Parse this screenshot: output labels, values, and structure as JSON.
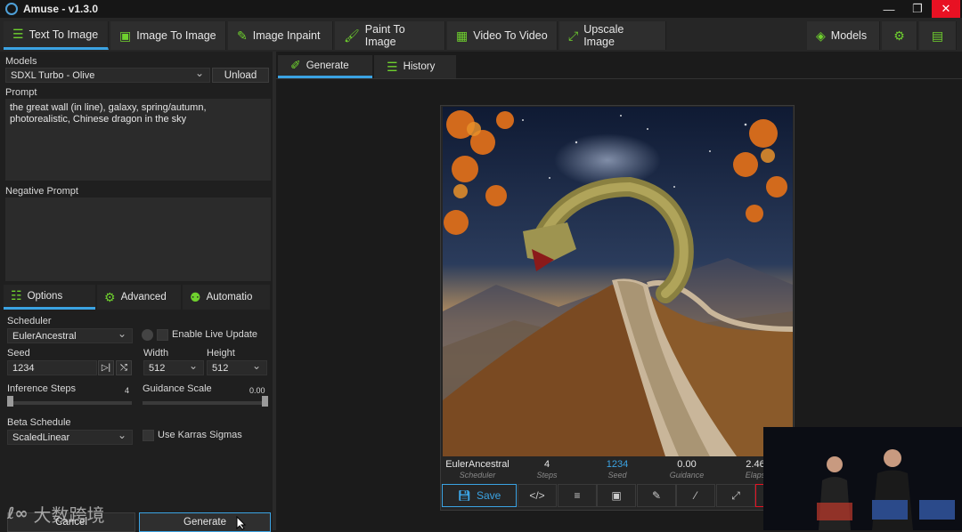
{
  "window": {
    "title": "Amuse - v1.3.0",
    "minimize": "—",
    "restore": "❐",
    "close": "✕"
  },
  "tabs": [
    {
      "label": "Text To Image",
      "icon": "text-lines-icon"
    },
    {
      "label": "Image To Image",
      "icon": "image-icon"
    },
    {
      "label": "Image Inpaint",
      "icon": "edit-icon"
    },
    {
      "label": "Paint To Image",
      "icon": "brush-icon"
    },
    {
      "label": "Video To Video",
      "icon": "film-icon"
    },
    {
      "label": "Upscale Image",
      "icon": "expand-icon"
    }
  ],
  "right_tabs": {
    "models": "Models"
  },
  "left": {
    "models_label": "Models",
    "model_value": "SDXL Turbo - Olive",
    "unload": "Unload",
    "prompt_label": "Prompt",
    "prompt_text": "the great wall (in line), galaxy, spring/autumn, photorealistic, Chinese dragon in the sky",
    "negative_label": "Negative Prompt",
    "negative_text": "",
    "subtabs": [
      "Options",
      "Advanced",
      "Automatio"
    ],
    "scheduler_label": "Scheduler",
    "scheduler_value": "EulerAncestral",
    "live_update": "Enable Live Update",
    "seed_label": "Seed",
    "seed_value": "1234",
    "width_label": "Width",
    "width_value": "512",
    "height_label": "Height",
    "height_value": "512",
    "steps_label": "Inference Steps",
    "steps_value": "4",
    "guidance_label": "Guidance Scale",
    "guidance_value": "0.00",
    "beta_label": "Beta Schedule",
    "beta_value": "ScaledLinear",
    "karras": "Use Karras Sigmas",
    "cancel": "Cancel",
    "generate": "Generate"
  },
  "right": {
    "tab_generate": "Generate",
    "tab_history": "History",
    "meta": [
      {
        "value": "EulerAncestral",
        "label": "Scheduler"
      },
      {
        "value": "4",
        "label": "Steps"
      },
      {
        "value": "1234",
        "label": "Seed"
      },
      {
        "value": "0.00",
        "label": "Guidance"
      },
      {
        "value": "2.46",
        "label": "Elaps"
      }
    ],
    "save": "Save"
  },
  "watermark": "大数跨境",
  "colors": {
    "accent": "#3ba3e3",
    "green": "#6fd12e",
    "close_red": "#e81123"
  }
}
